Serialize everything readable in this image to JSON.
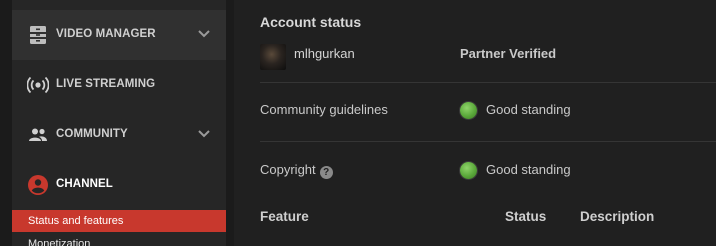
{
  "sidebar": {
    "items": [
      {
        "label": "VIDEO MANAGER",
        "icon": "video-manager-icon"
      },
      {
        "label": "LIVE STREAMING",
        "icon": "live-streaming-icon"
      },
      {
        "label": "COMMUNITY",
        "icon": "community-icon"
      },
      {
        "label": "CHANNEL",
        "icon": "channel-icon",
        "icon_color": "#c8382d"
      }
    ],
    "subitems": [
      {
        "label": "Status and features",
        "active": true
      },
      {
        "label": "Monetization"
      }
    ],
    "active_color": "#c8382d"
  },
  "main": {
    "title": "Account status",
    "account": {
      "username": "mlhgurkan",
      "partner_status": "Partner Verified"
    },
    "rows": [
      {
        "label": "Community guidelines",
        "status": "Good standing",
        "status_color": "#5aa83a"
      },
      {
        "label": "Copyright",
        "help_icon": "?",
        "status": "Good standing",
        "status_color": "#5aa83a"
      }
    ],
    "table_headers": {
      "feature": "Feature",
      "status": "Status",
      "description": "Description"
    }
  }
}
